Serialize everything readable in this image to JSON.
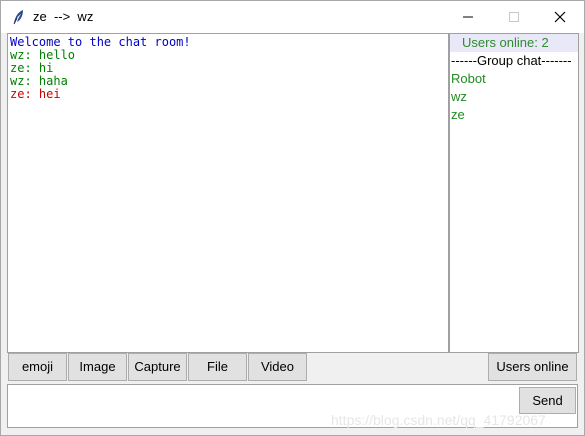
{
  "window": {
    "title": "ze  -->  wz",
    "icon": "feather-icon"
  },
  "chat": {
    "messages": [
      {
        "text": "Welcome to the chat room!",
        "color": "#0000c8"
      },
      {
        "text": "wz: hello",
        "color": "#008000"
      },
      {
        "text": "ze: hi",
        "color": "#008000"
      },
      {
        "text": "wz: haha",
        "color": "#008000"
      },
      {
        "text": "ze: hei",
        "color": "#c80000"
      }
    ]
  },
  "sidebar": {
    "header": "Users online: 2",
    "group_chat_label": "------Group chat-------",
    "users": [
      "Robot",
      "wz",
      "ze"
    ]
  },
  "toolbar": {
    "emoji_label": "emoji",
    "image_label": "Image",
    "capture_label": "Capture",
    "file_label": "File",
    "video_label": "Video",
    "users_online_label": "Users online"
  },
  "composer": {
    "input_value": "",
    "send_label": "Send"
  },
  "watermark": "https://blog.csdn.net/qq_41792067",
  "colors": {
    "system_message": "#0000c8",
    "other_user_message": "#008000",
    "own_message": "#c80000",
    "user_list": "#228b22"
  }
}
